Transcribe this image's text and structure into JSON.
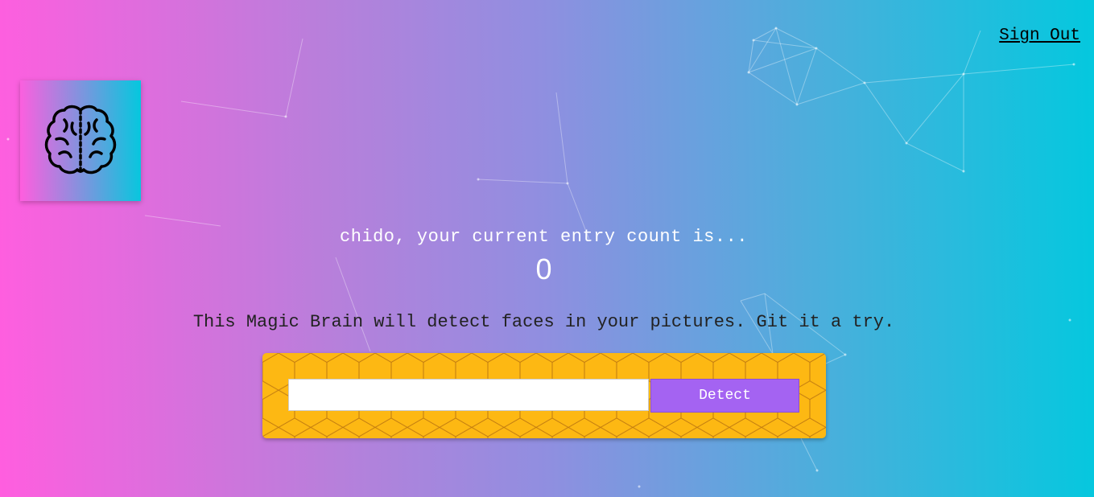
{
  "nav": {
    "sign_out_label": "Sign Out"
  },
  "logo": {
    "icon": "brain-icon"
  },
  "rank": {
    "greeting": "chido, your current entry count is...",
    "entry_count": "0"
  },
  "image_link_form": {
    "description": "This Magic Brain will detect faces in your pictures. Git it a try.",
    "input_value": "",
    "input_placeholder": "",
    "detect_label": "Detect"
  },
  "colors": {
    "gradient_start": "#ff5edf",
    "gradient_end": "#04c8de",
    "form_background": "#fdb813",
    "button": "#a463f2"
  }
}
